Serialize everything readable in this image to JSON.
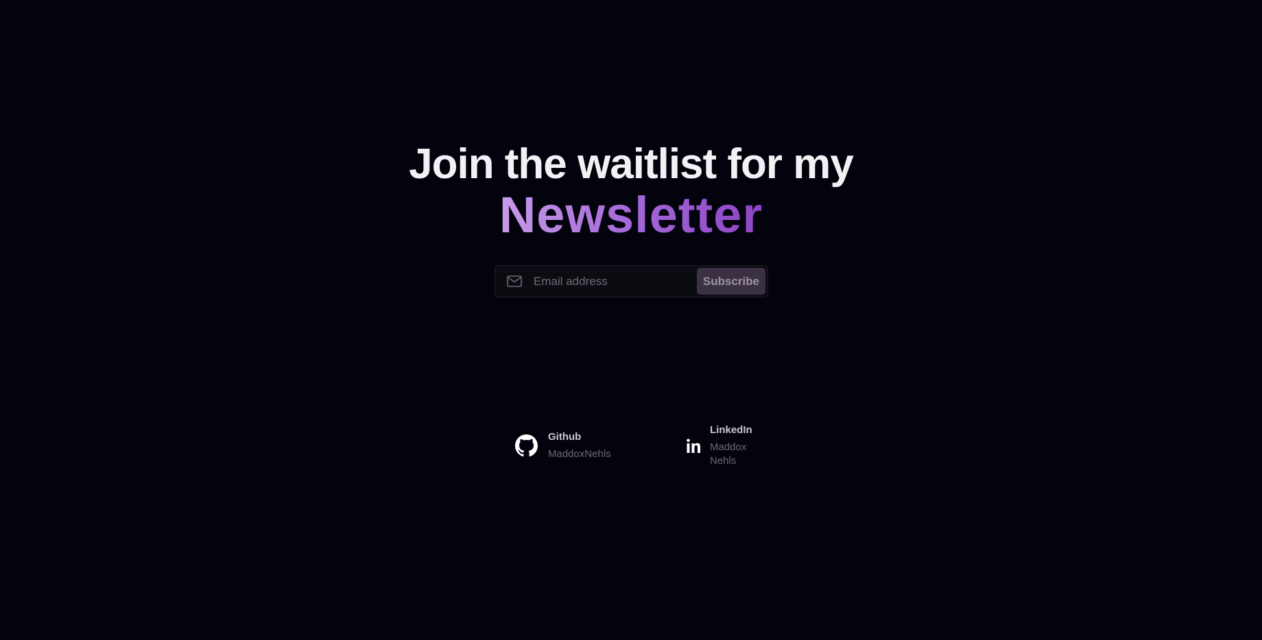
{
  "hero": {
    "headline": "Join the waitlist for my",
    "accent": "Newsletter"
  },
  "signup": {
    "email_placeholder": "Email address",
    "email_value": "",
    "mail_icon": "mail-icon",
    "subscribe_label": "Subscribe"
  },
  "socials": [
    {
      "icon": "github-icon",
      "title": "Github",
      "handle": "MaddoxNehls"
    },
    {
      "icon": "linkedin-icon",
      "title": "LinkedIn",
      "handle": "Maddox Nehls"
    }
  ],
  "colors": {
    "background": "#03030d",
    "accent_gradient_start": "#c79be9",
    "accent_gradient_end": "#8d45c4",
    "button_bg": "#3c3045"
  }
}
